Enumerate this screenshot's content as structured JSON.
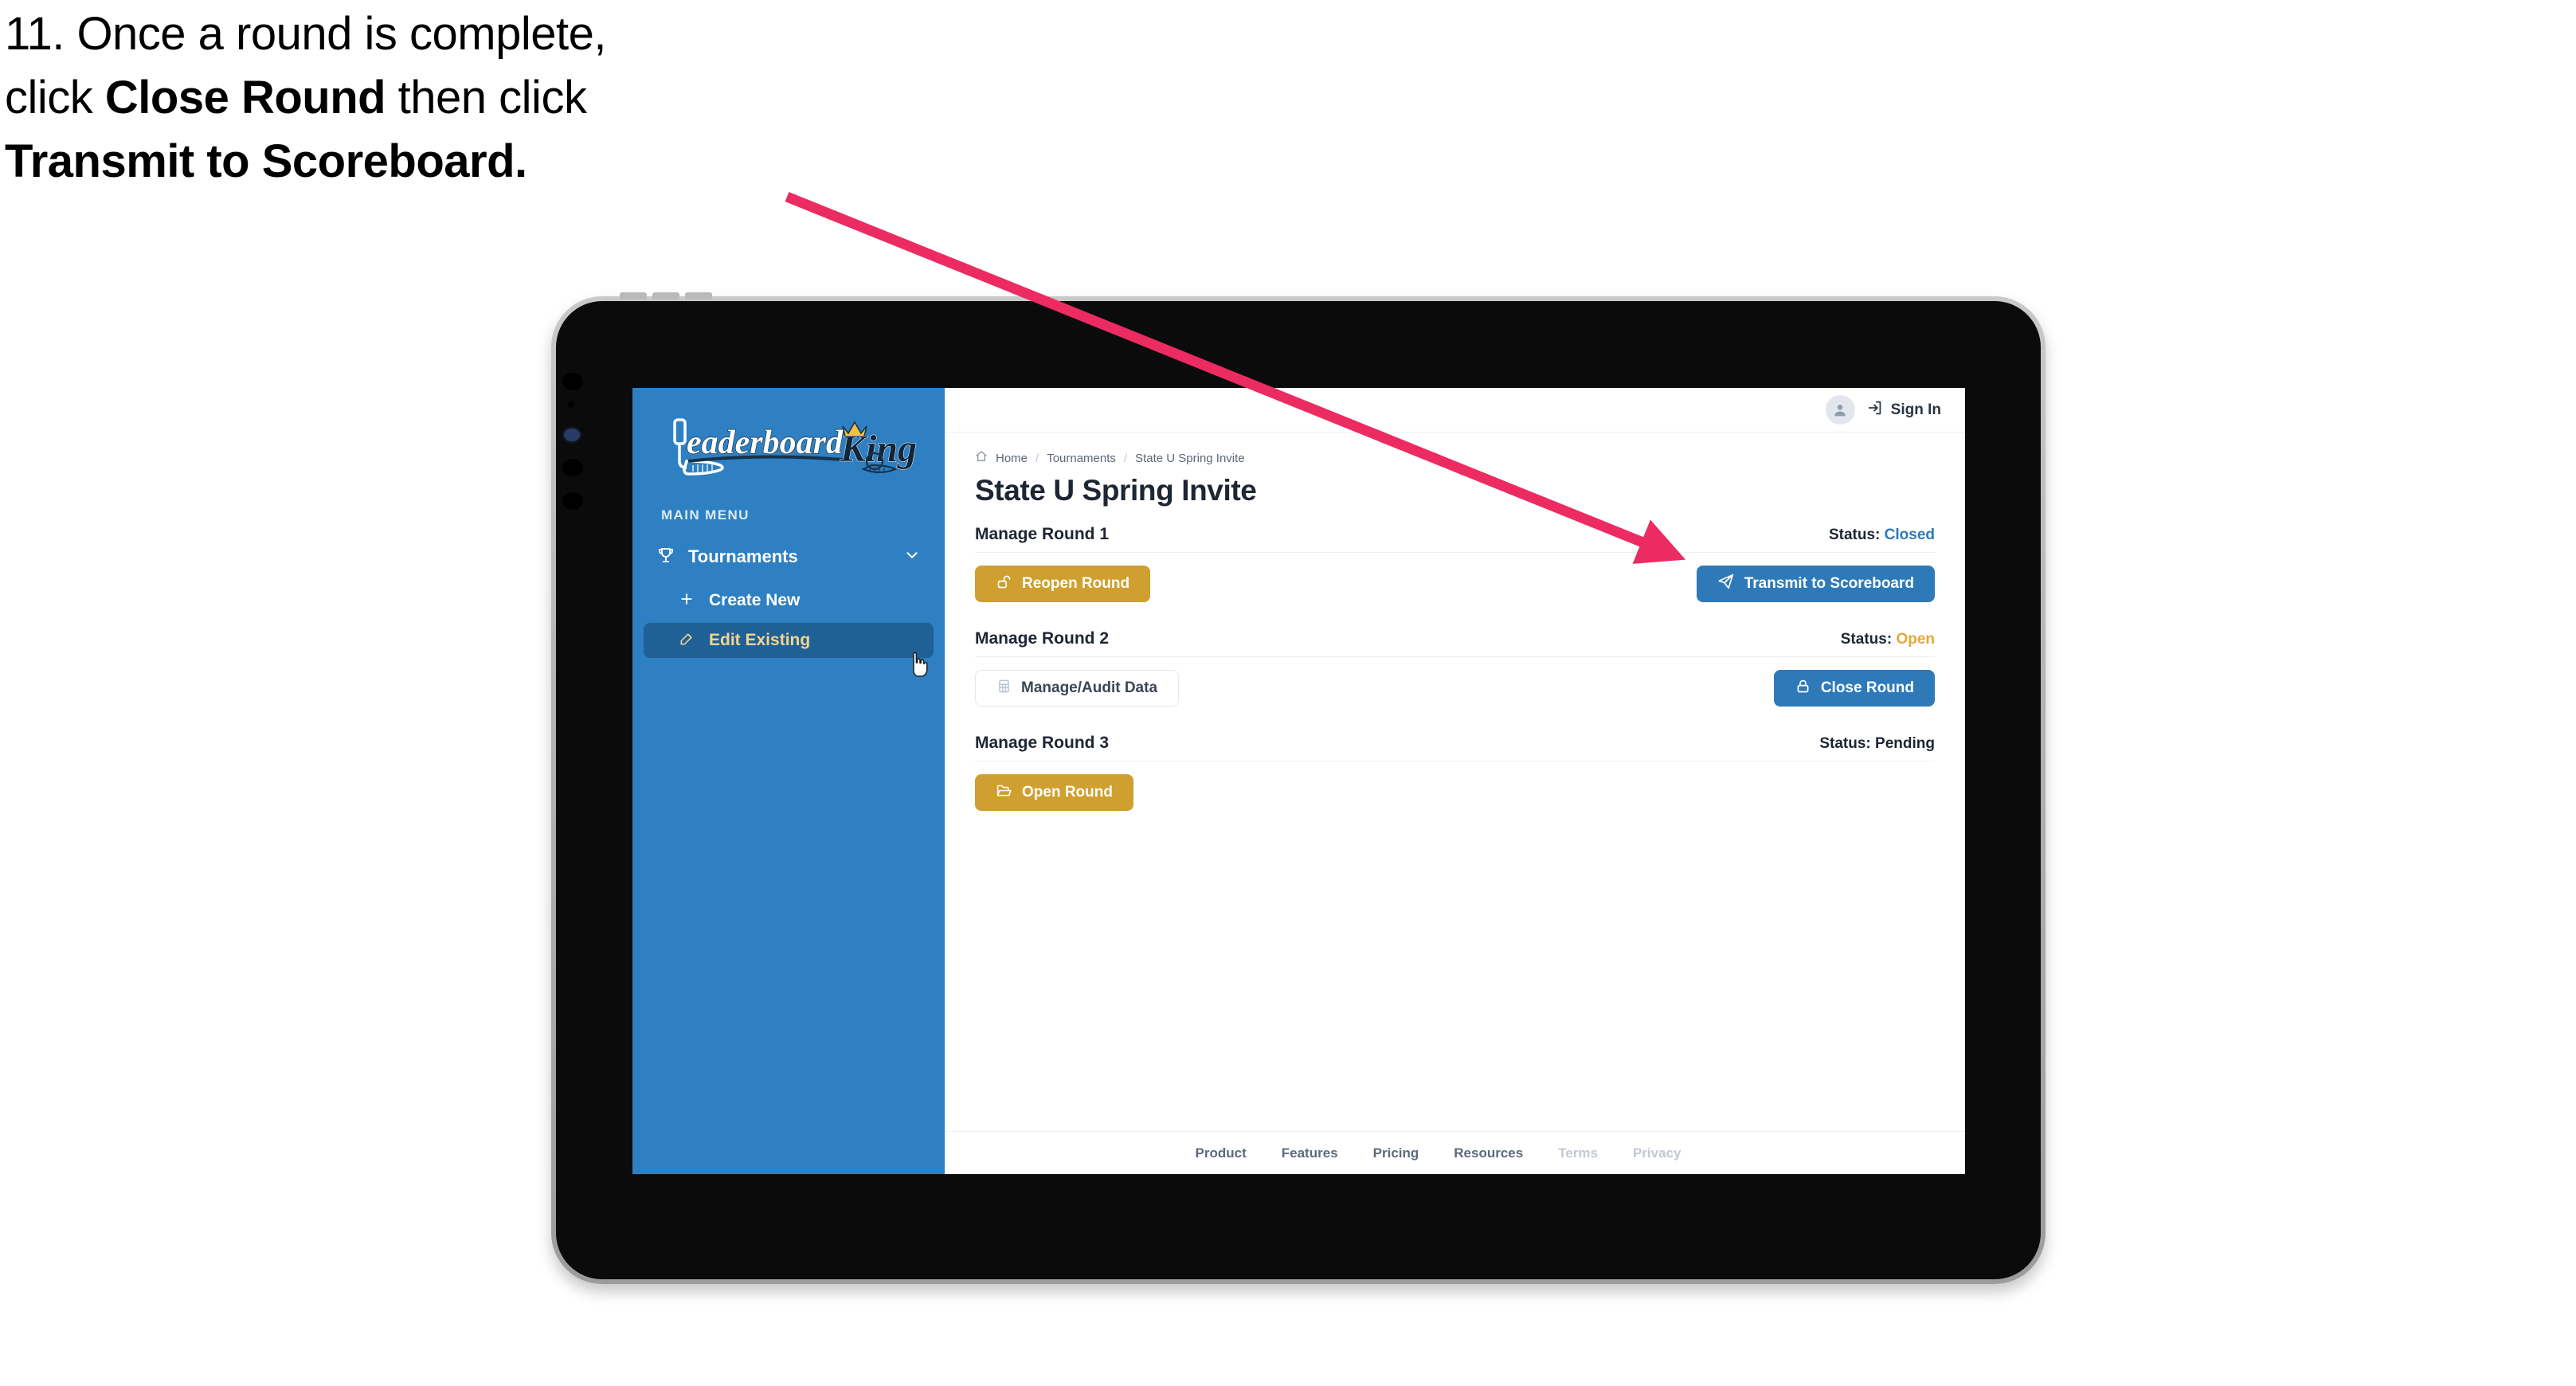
{
  "caption": {
    "line1": "11. Once a round is complete,",
    "line2_pre": "click ",
    "line2_bold": "Close Round",
    "line2_post": " then click",
    "line3_bold": "Transmit to Scoreboard."
  },
  "annotation": {
    "arrow_color": "#ec2b63",
    "arrow_name": "pointer-arrow"
  },
  "app": {
    "sidebar": {
      "logo_text_a": "Leaderboard",
      "logo_text_b": "King",
      "section_label": "MAIN MENU",
      "items": [
        {
          "label": "Tournaments",
          "icon": "trophy-icon",
          "expanded": true
        },
        {
          "label": "Create New",
          "icon": "plus-icon",
          "active": false
        },
        {
          "label": "Edit Existing",
          "icon": "edit-pencil-icon",
          "active": true
        }
      ],
      "background": "#2e80c2",
      "active_background": "#1f6096",
      "active_text_color": "#f2d591"
    },
    "topbar": {
      "avatar_icon": "user-avatar-icon",
      "signin_icon": "sign-in-arrow-icon",
      "signin_label": "Sign In"
    },
    "breadcrumb": {
      "home_icon": "home-icon",
      "items": [
        "Home",
        "Tournaments",
        "State U Spring Invite"
      ],
      "separator": "/"
    },
    "page_title": "State U Spring Invite",
    "rounds": [
      {
        "title": "Manage Round 1",
        "status_label": "Status:",
        "status_value": "Closed",
        "status_color": "#2e7ab8",
        "left_button": {
          "label": "Reopen Round",
          "icon": "unlock-icon",
          "style": "gold"
        },
        "right_button": {
          "label": "Transmit to Scoreboard",
          "icon": "paper-plane-icon",
          "style": "blue"
        }
      },
      {
        "title": "Manage Round 2",
        "status_label": "Status:",
        "status_value": "Open",
        "status_color": "#e2a93c",
        "left_button": {
          "label": "Manage/Audit Data",
          "icon": "table-grid-icon",
          "style": "ghost"
        },
        "right_button": {
          "label": "Close Round",
          "icon": "lock-icon",
          "style": "blue"
        }
      },
      {
        "title": "Manage Round 3",
        "status_label": "Status:",
        "status_value": "Pending",
        "status_color": "#1e2633",
        "left_button": {
          "label": "Open Round",
          "icon": "folder-open-icon",
          "style": "gold"
        },
        "right_button": null
      }
    ],
    "footer": {
      "links": [
        {
          "label": "Product",
          "muted": false
        },
        {
          "label": "Features",
          "muted": false
        },
        {
          "label": "Pricing",
          "muted": false
        },
        {
          "label": "Resources",
          "muted": false
        },
        {
          "label": "Terms",
          "muted": true
        },
        {
          "label": "Privacy",
          "muted": true
        }
      ]
    }
  }
}
